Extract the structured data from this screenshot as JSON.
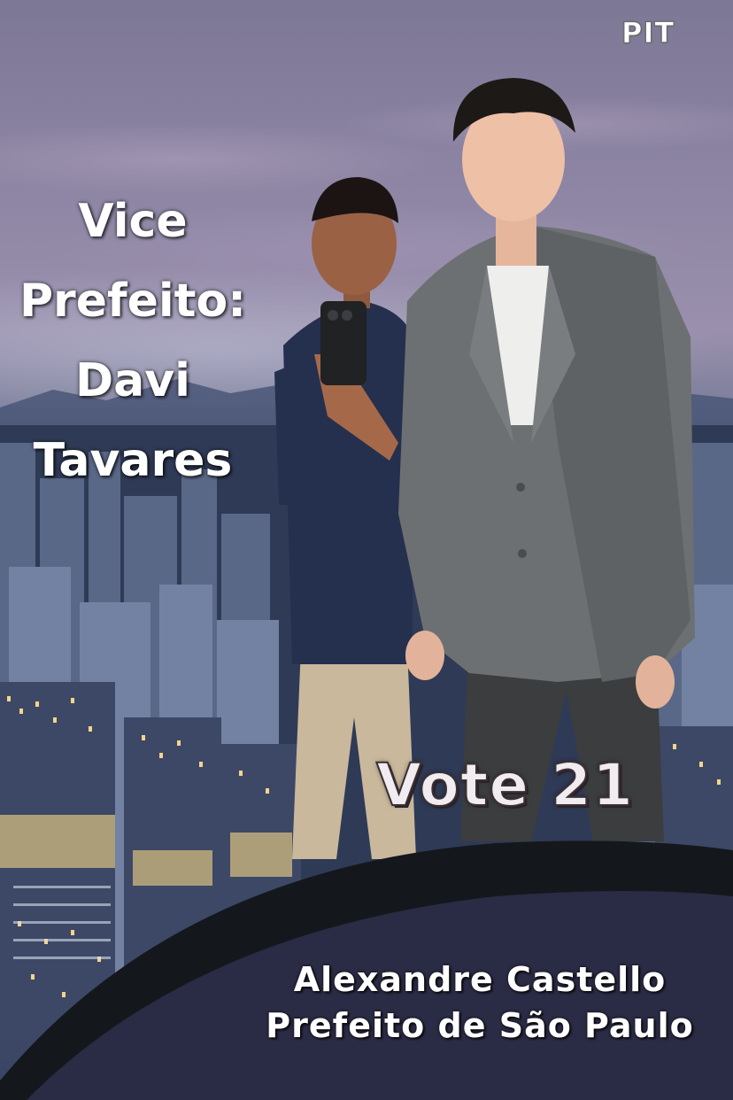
{
  "brand": {
    "logo_text": "PIT"
  },
  "vice": {
    "line1": "Vice",
    "line2": "Prefeito:",
    "line3": "Davi",
    "line4": "Tavares"
  },
  "vote": {
    "label": "Vote 21"
  },
  "candidate": {
    "name": "Alexandre Castello",
    "title": "Prefeito de São Paulo"
  },
  "colors": {
    "sky_top": "#7d7896",
    "band_dark": "#16191f",
    "band_panel": "#292a43",
    "text": "#ffffff"
  }
}
